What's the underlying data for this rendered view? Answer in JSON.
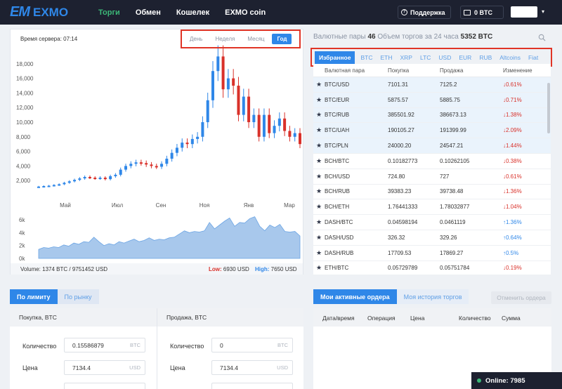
{
  "header": {
    "logo_mark": "EM",
    "logo_text": "EXMO",
    "nav": [
      "Торги",
      "Обмен",
      "Кошелек",
      "EXMO coin"
    ],
    "support": "Поддержка",
    "wallet": "0 BTC"
  },
  "chart_panel": {
    "server_time": "Время сервера: 07:14",
    "periods": [
      "День",
      "Неделя",
      "Месяц",
      "Год"
    ],
    "active_period": "Год",
    "volume": "Volume: 1374 BTC / 9751452 USD",
    "low_label": "Low:",
    "low_value": "6930 USD",
    "high_label": "High:",
    "high_value": "7650 USD"
  },
  "chart_data": [
    {
      "type": "candlestick",
      "y_ticks": [
        "18,000",
        "16,000",
        "14,000",
        "12,000",
        "10,000",
        "8,000",
        "6,000",
        "4,000",
        "2,000"
      ],
      "x_ticks": [
        "Май",
        "Июл",
        "Сен",
        "Ноя",
        "Янв",
        "Мар"
      ],
      "ylim": [
        0,
        20000
      ],
      "close_values": [
        1180,
        1250,
        1300,
        1400,
        1500,
        1700,
        1900,
        2100,
        2300,
        2500,
        2400,
        2300,
        2400,
        2200,
        2600,
        2800,
        3500,
        4000,
        4300,
        4500,
        4400,
        4200,
        4000,
        3900,
        4300,
        5000,
        5800,
        6500,
        7200,
        7000,
        7700,
        8000,
        10000,
        13000,
        17000,
        19000,
        14500,
        16000,
        15000,
        11000,
        13500,
        10000,
        11000,
        8000,
        11000,
        8500,
        9500,
        10500,
        8800,
        8000,
        8500,
        7000
      ]
    },
    {
      "type": "area",
      "y_ticks": [
        "6k",
        "4k",
        "2k",
        "0k"
      ],
      "ylim": [
        0,
        7000
      ],
      "values": [
        1400,
        1700,
        1600,
        1800,
        1700,
        2100,
        1900,
        2400,
        2200,
        2600,
        2500,
        3300,
        2600,
        2000,
        2300,
        2100,
        2600,
        2400,
        2700,
        3000,
        2600,
        2800,
        3200,
        2800,
        3000,
        2900,
        3200,
        3300,
        3800,
        4300,
        4000,
        4200,
        4100,
        4300,
        5600,
        4600,
        5200,
        5800,
        6300,
        5000,
        5600,
        5500,
        6200,
        6500,
        5000,
        4300,
        5200,
        4800,
        5300,
        4200,
        4100,
        4200,
        3500
      ]
    }
  ],
  "pairs_panel": {
    "head_prefix": "Валютные пары",
    "pairs_count": "46",
    "head_middle": "Объем торгов за 24 часа",
    "volume": "5352 BTC",
    "tabs": [
      "Избранное",
      "BTC",
      "ETH",
      "XRP",
      "LTC",
      "USD",
      "EUR",
      "RUB",
      "Altcoins",
      "Fiat"
    ],
    "columns": [
      "Валютная пара",
      "Покупка",
      "Продажа",
      "Изменение"
    ],
    "rows": [
      {
        "pair": "BTC/USD",
        "buy": "7101.31",
        "sell": "7125.2",
        "change": "0.61%",
        "dir": "down",
        "fav": true
      },
      {
        "pair": "BTC/EUR",
        "buy": "5875.57",
        "sell": "5885.75",
        "change": "0.71%",
        "dir": "down",
        "fav": true
      },
      {
        "pair": "BTC/RUB",
        "buy": "385501.92",
        "sell": "386673.13",
        "change": "1.38%",
        "dir": "down",
        "fav": true
      },
      {
        "pair": "BTC/UAH",
        "buy": "190105.27",
        "sell": "191399.99",
        "change": "2.09%",
        "dir": "down",
        "fav": true
      },
      {
        "pair": "BTC/PLN",
        "buy": "24000.20",
        "sell": "24547.21",
        "change": "1.44%",
        "dir": "down",
        "fav": true
      },
      {
        "pair": "BCH/BTC",
        "buy": "0.10182773",
        "sell": "0.10262105",
        "change": "0.38%",
        "dir": "down",
        "fav": false
      },
      {
        "pair": "BCH/USD",
        "buy": "724.80",
        "sell": "727",
        "change": "0.61%",
        "dir": "down",
        "fav": false
      },
      {
        "pair": "BCH/RUB",
        "buy": "39383.23",
        "sell": "39738.48",
        "change": "1.36%",
        "dir": "down",
        "fav": false
      },
      {
        "pair": "BCH/ETH",
        "buy": "1.76441333",
        "sell": "1.78032877",
        "change": "1.04%",
        "dir": "down",
        "fav": false
      },
      {
        "pair": "DASH/BTC",
        "buy": "0.04598194",
        "sell": "0.0461119",
        "change": "1.36%",
        "dir": "up",
        "fav": false
      },
      {
        "pair": "DASH/USD",
        "buy": "326.32",
        "sell": "329.26",
        "change": "0.64%",
        "dir": "up",
        "fav": false
      },
      {
        "pair": "DASH/RUB",
        "buy": "17709.53",
        "sell": "17869.27",
        "change": "0.5%",
        "dir": "up",
        "fav": false
      },
      {
        "pair": "ETH/BTC",
        "buy": "0.05729789",
        "sell": "0.05751784",
        "change": "0.19%",
        "dir": "down",
        "fav": false
      }
    ]
  },
  "trade": {
    "tabs": [
      "По лимиту",
      "По рынку"
    ],
    "buy_head": "Покупка, BTC",
    "sell_head": "Продажа, BTC",
    "qty_label": "Количество",
    "price_label": "Цена",
    "buy_qty": "0.15586879",
    "buy_qty_unit": "BTC",
    "buy_price": "7134.4",
    "buy_price_unit": "USD",
    "sell_qty": "0",
    "sell_qty_unit": "BTC",
    "sell_price": "7134.4",
    "sell_price_unit": "USD"
  },
  "orders": {
    "tabs": [
      "Мои активные ордера",
      "Моя история торгов"
    ],
    "cancel": "Отменить ордера",
    "columns": [
      "Дата/время",
      "Операция",
      "Цена",
      "Количество",
      "Сумма"
    ]
  },
  "online": "Online: 7985",
  "colors": {
    "accent": "#2f87e8",
    "up": "#2f87e8",
    "down": "#d9312a",
    "nav_active": "#3cb878",
    "highlight": "#e03426"
  }
}
